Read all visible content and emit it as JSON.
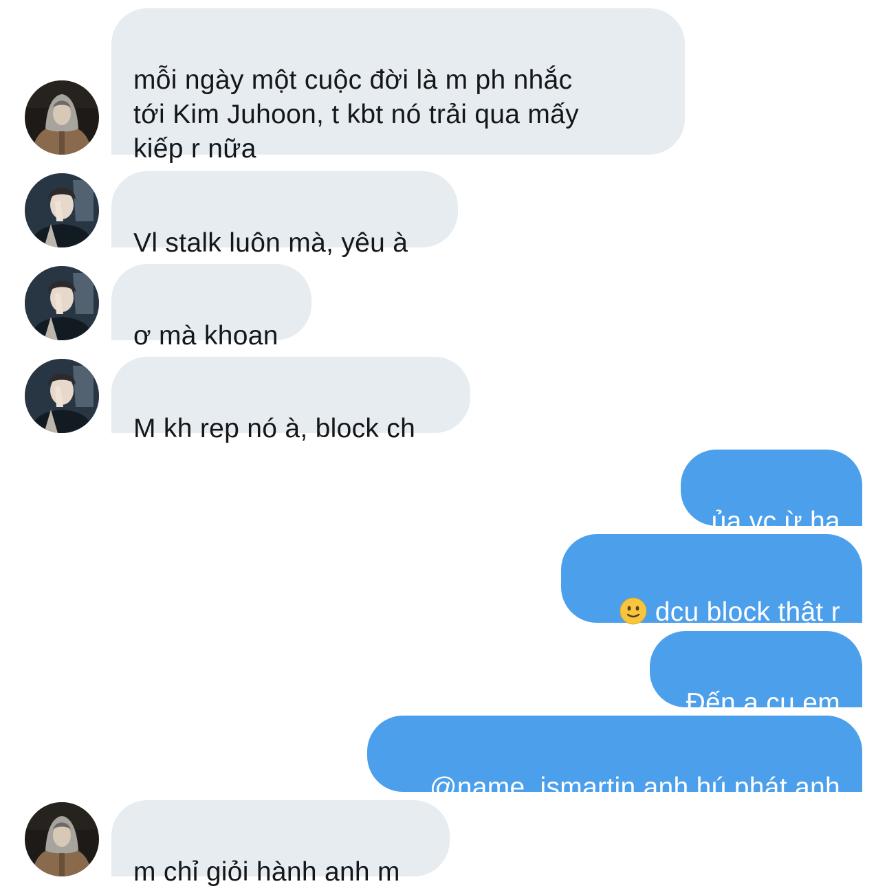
{
  "messages": [
    {
      "direction": "incoming",
      "avatar": "avatar-hoodie-icon",
      "text": "mỗi ngày một cuộc đời là m ph nhắc\ntới Kim Juhoon, t kbt nó trải qua mấy\nkiếp r nữa"
    },
    {
      "direction": "incoming",
      "avatar": "avatar-covering-face-icon",
      "text": "Vl stalk luôn mà, yêu à"
    },
    {
      "direction": "incoming",
      "avatar": "avatar-covering-face-icon",
      "text": "ơ mà khoan"
    },
    {
      "direction": "incoming",
      "avatar": "avatar-covering-face-icon",
      "text": "M kh rep nó à, block ch"
    },
    {
      "direction": "outgoing",
      "text": "ủa vc ừ ha"
    },
    {
      "direction": "outgoing",
      "emoji": "slightly-smiling-face-icon",
      "text": "dcu block thật r"
    },
    {
      "direction": "outgoing",
      "text": "Đến ạ cu em"
    },
    {
      "direction": "outgoing",
      "text": "@name_ismartin anh hú phát anh"
    },
    {
      "direction": "incoming",
      "avatar": "avatar-hoodie-icon",
      "text": "m chỉ giỏi hành anh m"
    }
  ],
  "colors": {
    "incoming_bubble": "#e6ecf0",
    "incoming_text": "#14171a",
    "outgoing_bubble": "#4c9feb",
    "outgoing_text": "#ffffff",
    "background": "#ffffff"
  }
}
